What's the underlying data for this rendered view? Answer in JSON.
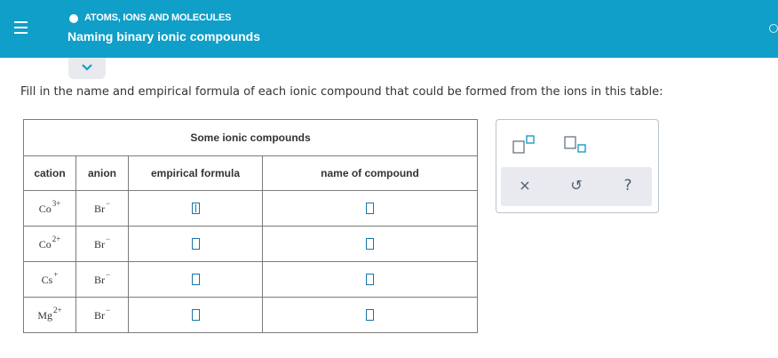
{
  "header": {
    "topic": "ATOMS, IONS AND MOLECULES",
    "title": "Naming binary ionic compounds"
  },
  "instruction": "Fill in the name and empirical formula of each ionic compound that could be formed from the ions in this table:",
  "table": {
    "caption": "Some ionic compounds",
    "columns": [
      "cation",
      "anion",
      "empirical formula",
      "name of compound"
    ],
    "rows": [
      {
        "cation": {
          "symbol": "Co",
          "charge": "3+"
        },
        "anion": {
          "symbol": "Br",
          "charge": "−"
        },
        "empirical_formula": "",
        "name": ""
      },
      {
        "cation": {
          "symbol": "Co",
          "charge": "2+"
        },
        "anion": {
          "symbol": "Br",
          "charge": "−"
        },
        "empirical_formula": "",
        "name": ""
      },
      {
        "cation": {
          "symbol": "Cs",
          "charge": "+"
        },
        "anion": {
          "symbol": "Br",
          "charge": "−"
        },
        "empirical_formula": "",
        "name": ""
      },
      {
        "cation": {
          "symbol": "Mg",
          "charge": "2+"
        },
        "anion": {
          "symbol": "Br",
          "charge": "−"
        },
        "empirical_formula": "",
        "name": ""
      }
    ]
  },
  "tools": {
    "icons": [
      "superscript-icon",
      "subscript-icon",
      "clear-icon",
      "undo-icon",
      "help-icon"
    ],
    "clear_label": "×",
    "undo_label": "↺",
    "help_label": "?"
  },
  "colors": {
    "header_bg": "#0f9fc8",
    "input_border": "#1b73a8"
  }
}
